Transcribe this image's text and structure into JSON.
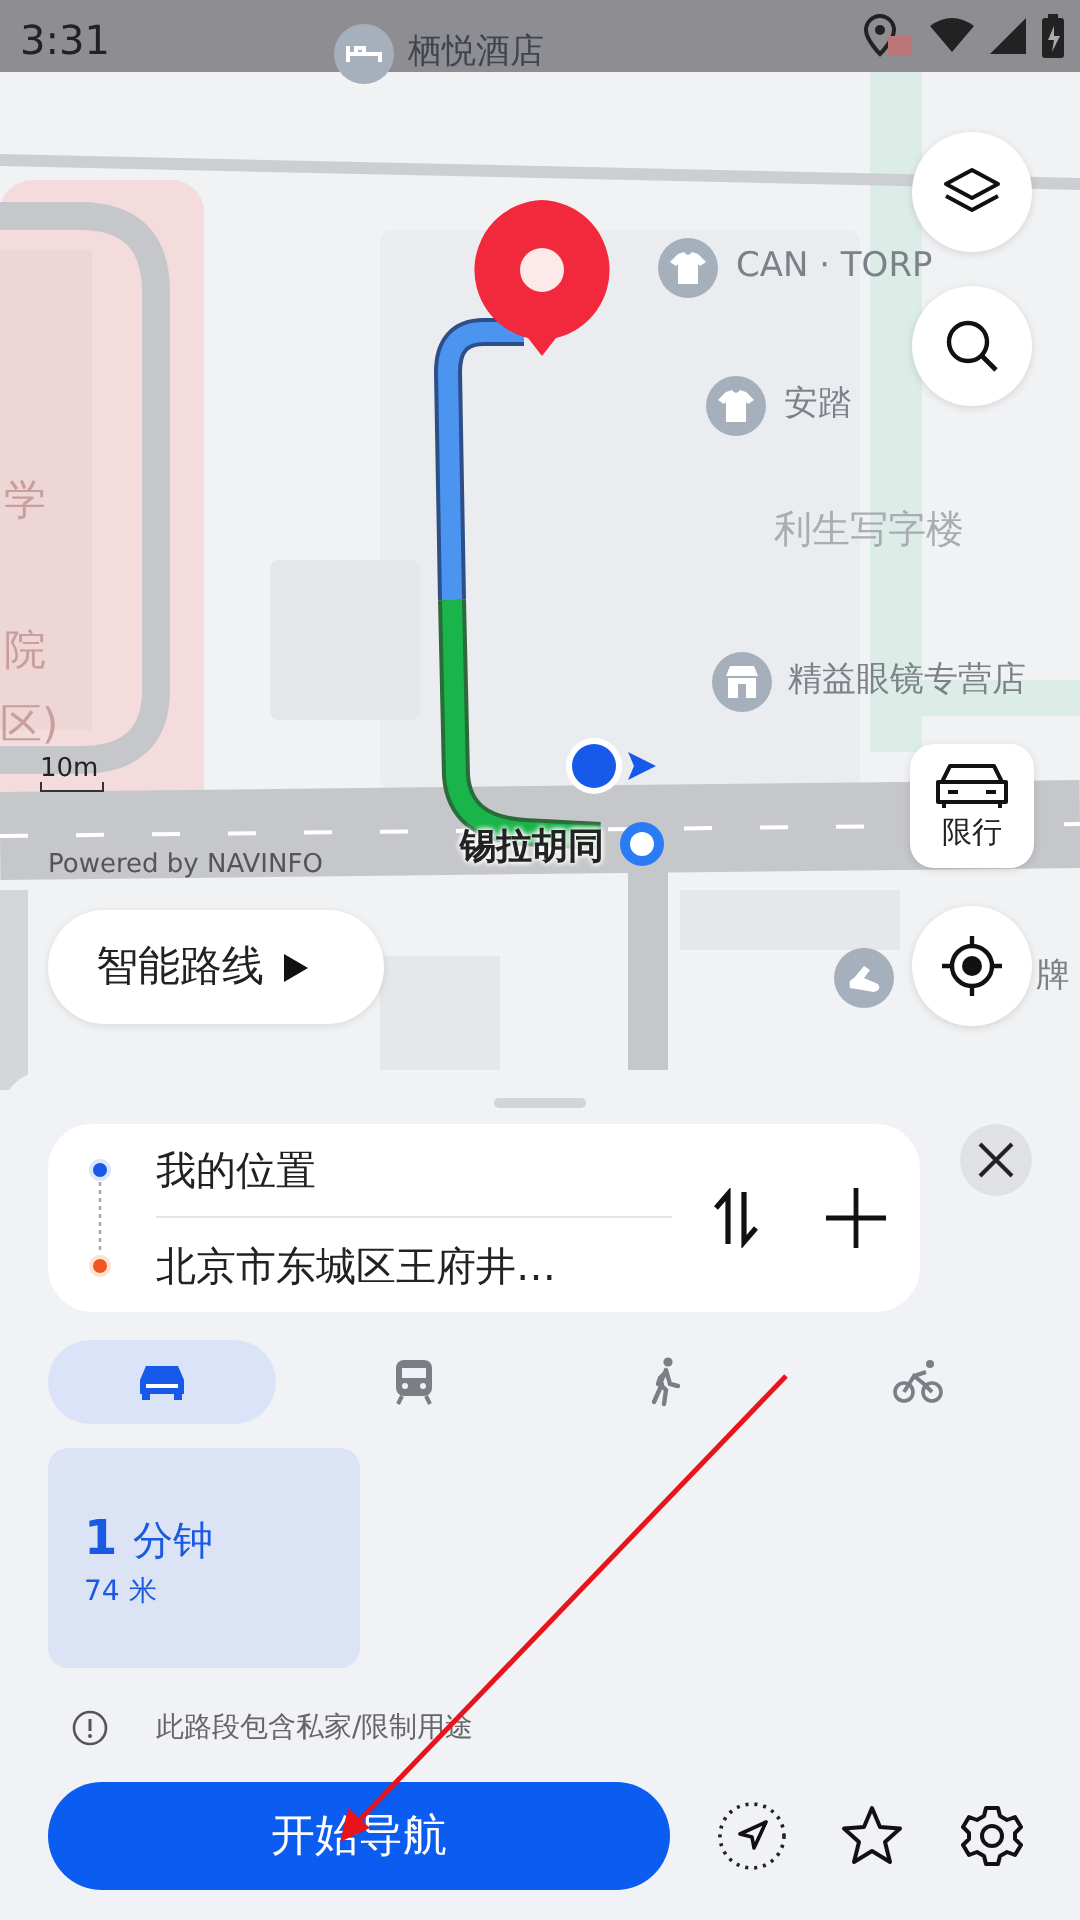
{
  "status_bar": {
    "time": "3:31"
  },
  "map": {
    "labels": [
      {
        "text": "栖悦酒店",
        "kind": "poi"
      },
      {
        "text": "CAN · TORP",
        "kind": "poi"
      },
      {
        "text": "安踏",
        "kind": "poi"
      },
      {
        "text": "利生写字楼",
        "kind": "building"
      },
      {
        "text": "精益眼镜专营店",
        "kind": "poi"
      },
      {
        "text": "学",
        "kind": "area"
      },
      {
        "text": "院",
        "kind": "area"
      },
      {
        "text": "区)",
        "kind": "area"
      },
      {
        "text": "锡拉胡同",
        "kind": "street"
      },
      {
        "text": "牌",
        "kind": "poi"
      }
    ],
    "scale": "10m",
    "attribution": "Powered by NAVINFO",
    "restriction_button": {
      "label": "限行"
    },
    "smart_route_button": {
      "label": "智能路线"
    }
  },
  "route": {
    "origin": "我的位置",
    "destination": "北京市东城区王府井…"
  },
  "modes": [
    {
      "kind": "car",
      "selected": true
    },
    {
      "kind": "transit",
      "selected": false
    },
    {
      "kind": "walk",
      "selected": false
    },
    {
      "kind": "bike",
      "selected": false
    }
  ],
  "options": [
    {
      "minutes": "1",
      "unit": "分钟",
      "distance": "74 米",
      "selected": true
    }
  ],
  "notice": "此路段包含私家/限制用途",
  "start_button": "开始导航"
}
